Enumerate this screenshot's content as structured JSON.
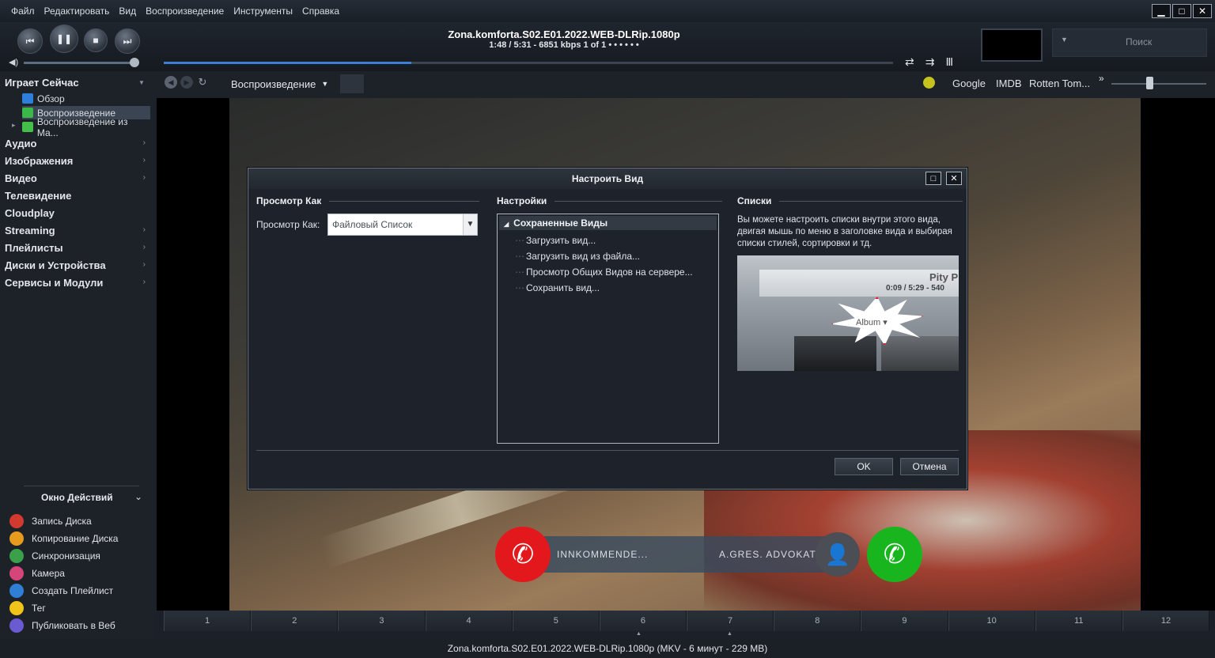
{
  "menu": [
    "Файл",
    "Редактировать",
    "Вид",
    "Воспроизведение",
    "Инструменты",
    "Справка"
  ],
  "window_controls": {
    "minimize": "▁",
    "maximize": "□",
    "close": "✕"
  },
  "transport": {
    "prev_icon": "⏮",
    "pause_icon": "❚❚",
    "stop_icon": "■",
    "next_icon": "⏭",
    "volume_icon": "◀)",
    "now_playing_title": "Zona.komforta.S02.E01.2022.WEB-DLRip.1080p",
    "now_playing_info": "1:48 / 5:31 - 6851 kbps   1 of 1  •  •  •  •  •  •",
    "progress": 0.34,
    "search_placeholder": "Поиск",
    "search_arrow": "▼",
    "mode_icons": [
      "⇄",
      "⇉",
      "Ⅲ"
    ]
  },
  "sidebar": {
    "header": "Играет Сейчас",
    "header_arrow": "▼",
    "subitems": [
      {
        "label": "Обзор",
        "color": "#2d7fdb"
      },
      {
        "label": "Воспроизведение",
        "color": "#3cb84a"
      },
      {
        "label": "Воспроизведение из Ма...",
        "color": "#44c04a"
      }
    ],
    "expander": "▸",
    "items": [
      "Аудио",
      "Изображения",
      "Видео",
      "Телевидение",
      "Cloudplay",
      "Streaming",
      "Плейлисты",
      "Диски и Устройства",
      "Сервисы и Модули"
    ],
    "chevron": "›",
    "action_header": "Окно Действий",
    "action_toggle": "⌄",
    "actions": [
      {
        "label": "Запись Диска",
        "color": "#d23a2f"
      },
      {
        "label": "Копирование Диска",
        "color": "#e69a1e"
      },
      {
        "label": "Синхронизация",
        "color": "#3aa04a"
      },
      {
        "label": "Камера",
        "color": "#d6457a"
      },
      {
        "label": "Создать Плейлист",
        "color": "#2f7fd6"
      },
      {
        "label": "Тег",
        "color": "#f0c419"
      },
      {
        "label": "Публиковать в Веб",
        "color": "#6a5bd1"
      }
    ]
  },
  "toolbar": {
    "back_icon": "◀",
    "forward_icon": "▶",
    "refresh_icon": "↻",
    "view_tab": "Воспроизведение",
    "view_tab_arrow": "▼",
    "links": [
      "Google",
      "IMDB",
      "Rotten Tom..."
    ],
    "more_icon": "»"
  },
  "video": {
    "call_left": "INNKOMMENDE...",
    "call_right": "A.GRES. ADVOKAT",
    "decline_icon": "✆",
    "accept_icon": "✆",
    "avatar_icon": "👤"
  },
  "chapters": [
    "1",
    "2",
    "3",
    "4",
    "5",
    "6",
    "7",
    "8",
    "9",
    "10",
    "11",
    "12"
  ],
  "chapter_mark": "▲",
  "status": "Zona.komforta.S02.E01.2022.WEB-DLRip.1080p (MKV - 6 минут - 229 MB)",
  "dialog": {
    "title": "Настроить Вид",
    "max_icon": "□",
    "close_icon": "✕",
    "col1_header": "Просмотр Как",
    "view_as_label": "Просмотр Как:",
    "view_as_value": "Файловый Список",
    "dropdown_icon": "▼",
    "col2_header": "Настройки",
    "tree_header": "Сохраненные Виды",
    "tree_expander": "◢",
    "tree_items": [
      "Загрузить вид...",
      "Загрузить вид из файла...",
      "Просмотр Общих Видов на сервере...",
      "Сохранить вид..."
    ],
    "col3_header": "Списки",
    "description": "Вы можете настроить списки внутри этого вида, двигая мышь по меню в заголовке вида и выбирая списки стилей, сортировки и тд.",
    "hint": {
      "time": "0:09 / 5:29 - 540",
      "pity": "Pity P",
      "album": "Album ▾"
    },
    "ok": "OK",
    "cancel": "Отмена"
  }
}
